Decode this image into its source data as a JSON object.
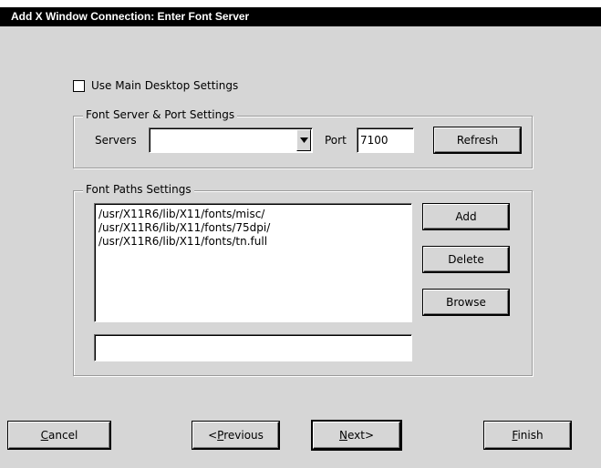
{
  "window": {
    "title": "Add X Window Connection: Enter Font Server"
  },
  "use_main_desktop": {
    "label": "Use Main Desktop Settings",
    "checked": false
  },
  "font_server_group": {
    "legend": "Font  Server & Port Settings",
    "servers_label": "Servers",
    "servers_value": "",
    "port_label": "Port",
    "port_value": "7100",
    "refresh_label": "Refresh"
  },
  "font_paths_group": {
    "legend": "Font Paths Settings",
    "paths": [
      "/usr/X11R6/lib/X11/fonts/misc/",
      "/usr/X11R6/lib/X11/fonts/75dpi/",
      "/usr/X11R6/lib/X11/fonts/tn.full"
    ],
    "path_input_value": "",
    "add_label": "Add",
    "delete_label": "Delete",
    "browse_label": "Browse"
  },
  "footer": {
    "cancel": {
      "mnemonic": "C",
      "rest": "ancel"
    },
    "previous": {
      "prefix": "<",
      "mnemonic": "P",
      "rest": "revious"
    },
    "next": {
      "mnemonic": "N",
      "rest": "ext>"
    },
    "finish": {
      "mnemonic": "F",
      "rest": "inish"
    }
  }
}
